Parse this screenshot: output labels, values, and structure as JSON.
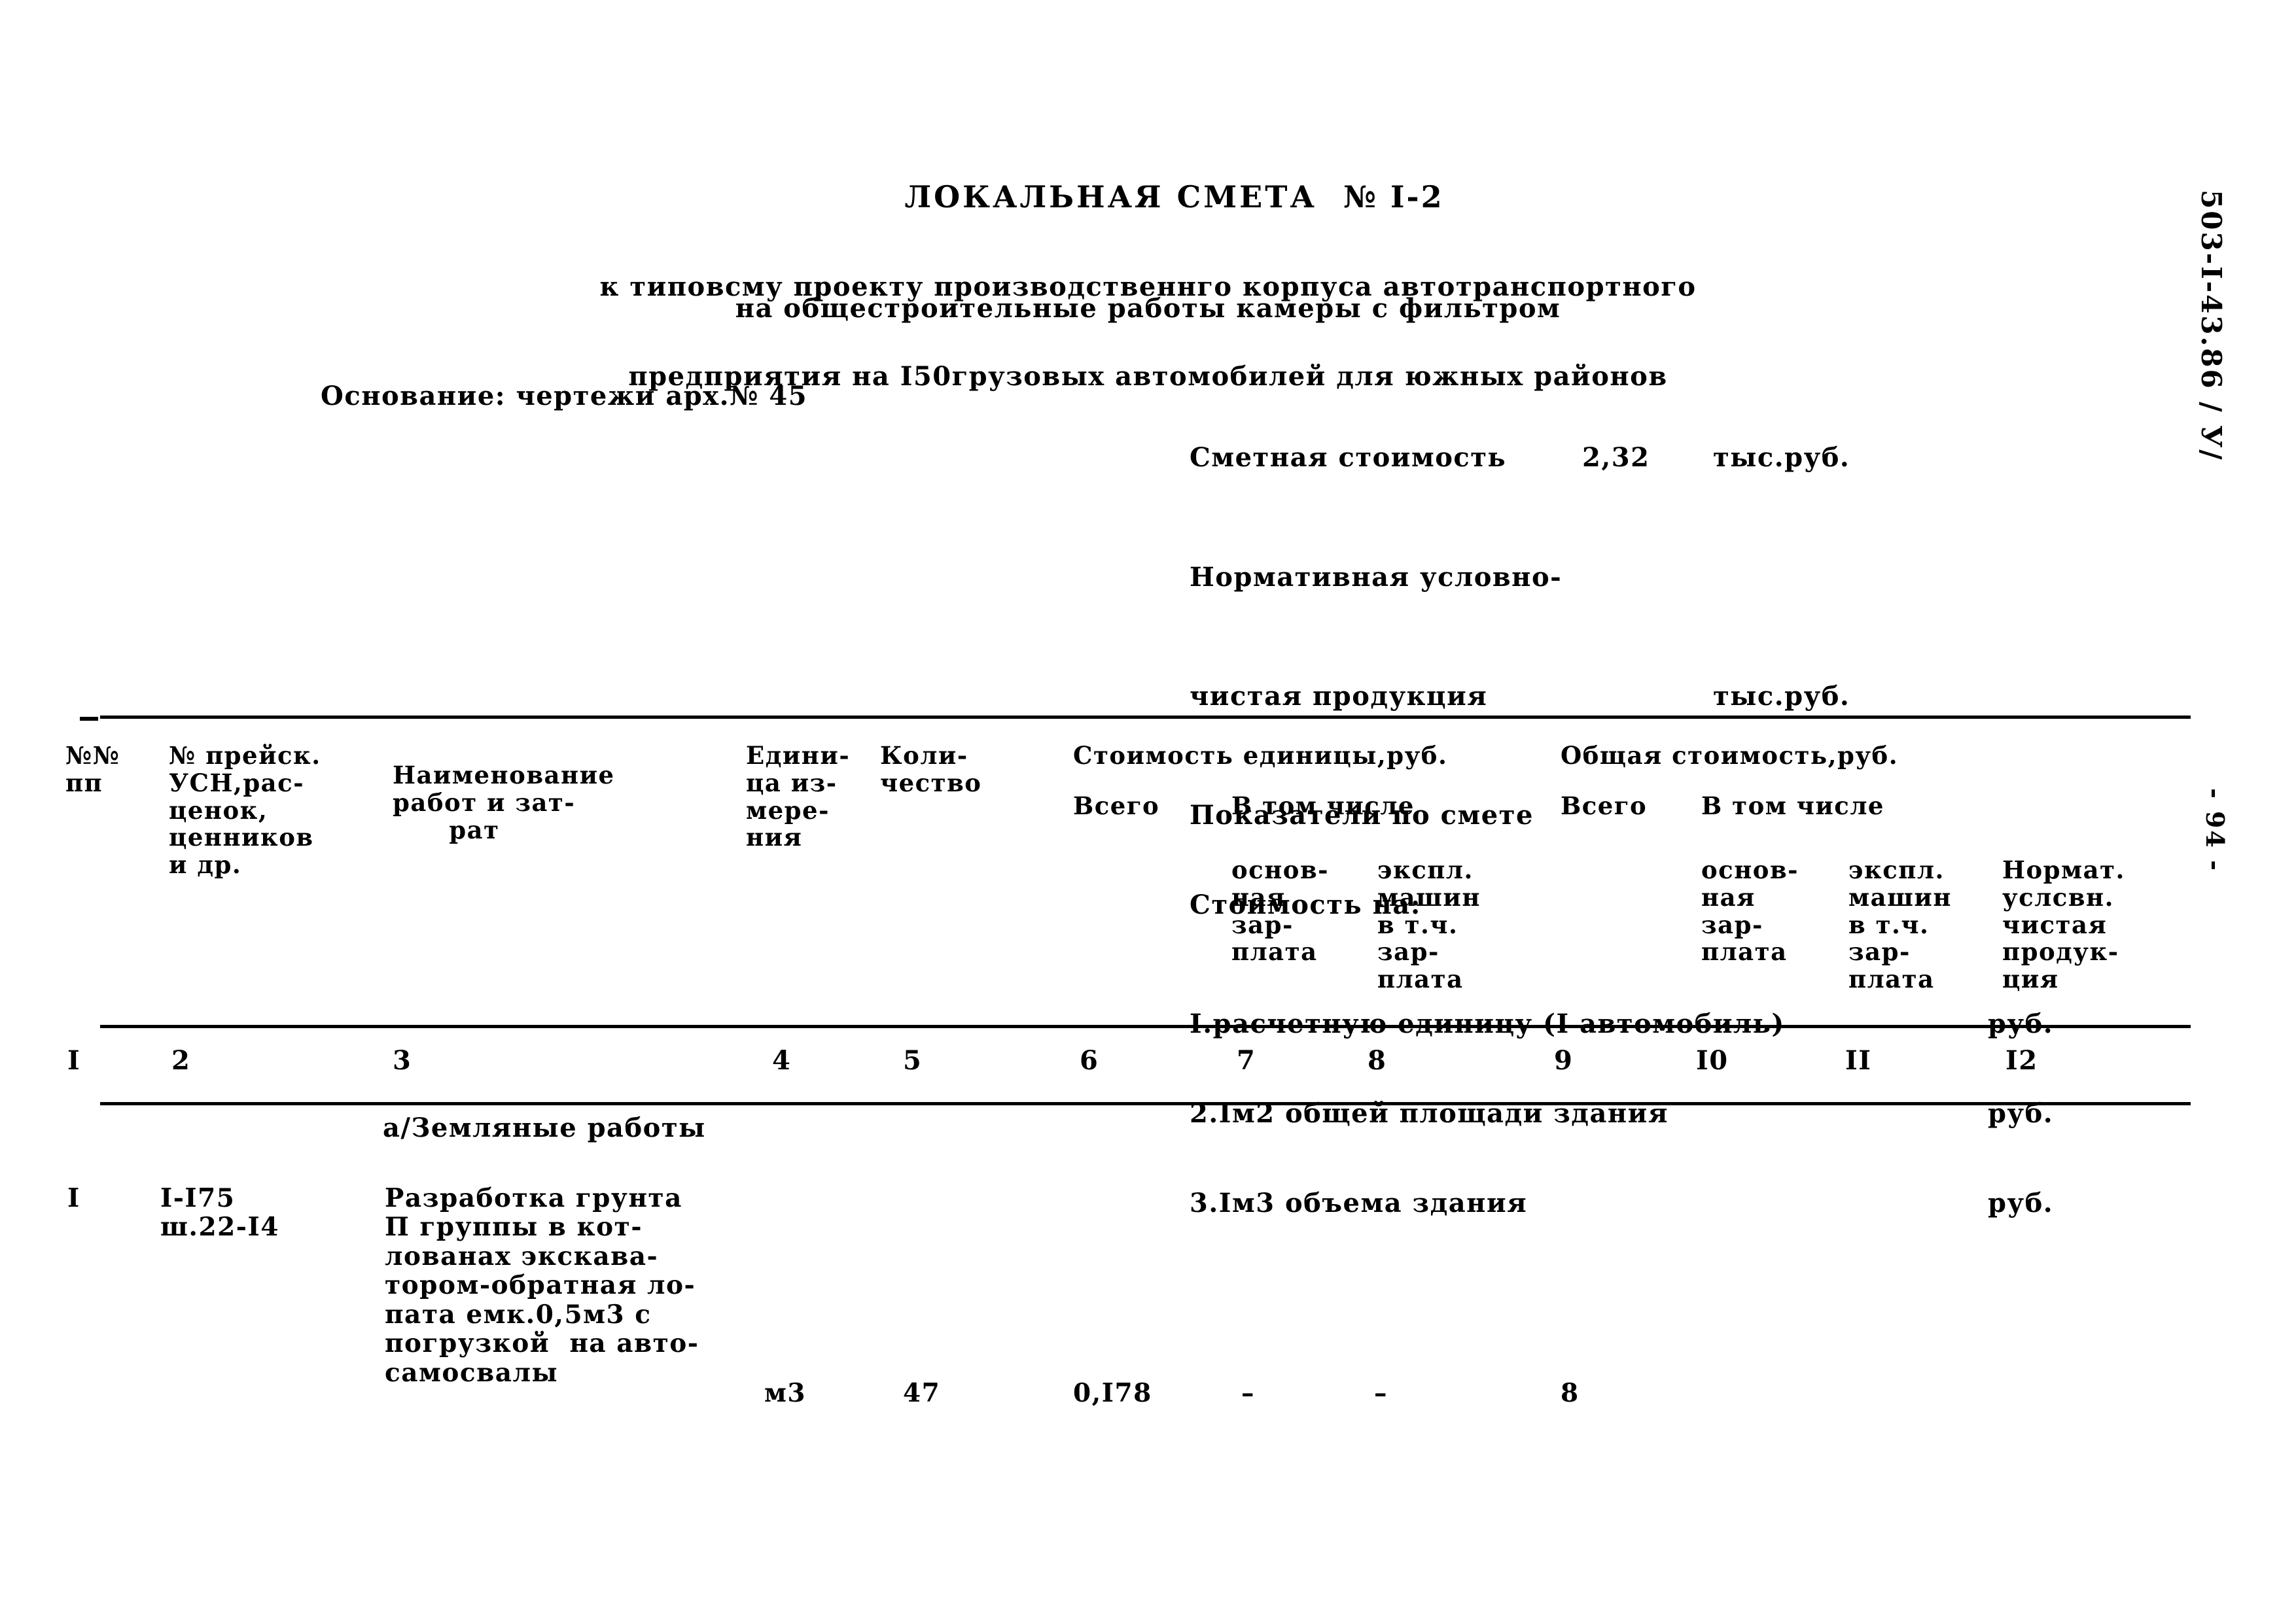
{
  "document": {
    "title_main": "ЛОКАЛЬНАЯ СМЕТА",
    "title_number": "№ I-2",
    "subtitle_line1": "к типовсму проекту производственнго кoрпуса автотранспортного",
    "subtitle_line2": "предприятия на I50грузовых автомобилей для южных районов",
    "subtitle_line3": "на общестроительные работы камеры с фильтром",
    "basis": "Основание: чертежи арх.№ 45",
    "margin_code": "503-I-43.86 / У/",
    "page_number": "- 94 -"
  },
  "summary": {
    "estimate_cost_label": "Сметная стоимость",
    "estimate_cost_value": "2,32",
    "estimate_cost_unit": "тыс.руб.",
    "net_output_label_line1": "Нормативная условно-",
    "net_output_label_line2": "чистая продукция",
    "net_output_value": "",
    "net_output_unit": "тыс.руб.",
    "indicators_label": "Показатели по смете",
    "cost_per_label": "Стоимость на:",
    "items": [
      {
        "label": "I.расчетную единицу (I автомобиль)",
        "value": "",
        "unit": "руб."
      },
      {
        "label": "2.Iм2 общей площади здания",
        "value": "",
        "unit": "руб."
      },
      {
        "label": "3.Iм3 объема здания",
        "value": "",
        "unit": "руб."
      }
    ]
  },
  "table": {
    "headers": {
      "c1": "№№\nпп",
      "c2": "№ прейск.\nУСН,рас-\nценок,\nценников\nи др.",
      "c3": "Наименование\nработ и зат-\n      рат",
      "c4": "Едини-\nца из-\nмере-\nния",
      "c5": "Коли-\nчество",
      "group_unit_cost": "Стоимость единицы,руб.",
      "group_total_cost": "Общая стоимость,руб.",
      "c6": "Всего",
      "c7_8_group": "В том числе",
      "c7": "основ-\nная\nзар-\nплата",
      "c8": "экспл.\nмашин\nв т.ч.\nзар-\nплата",
      "c9": "Всего",
      "c10_11_group": "В том числе",
      "c10": "основ-\nная\nзар-\nплата",
      "c11": "экспл.\nмашин\nв т.ч.\nзар-\nплата",
      "c12": "Нормат.\nуслсвн.\nчистая\nпродук-\nция"
    },
    "column_numbers": [
      "I",
      "2",
      "3",
      "4",
      "5",
      "6",
      "7",
      "8",
      "9",
      "I0",
      "II",
      "I2"
    ],
    "section_label": "а/Земляные работы",
    "rows": [
      {
        "c1": "I",
        "c2": "I-I75\nш.22-I4",
        "c3": "Разработка грунта\nП группы в кот-\nлованах экскава-\nтором-обратная ло-\nпата емк.0,5м3 с\nпогрузкой  на авто-\nсамосвалы",
        "c4": "м3",
        "c5": "47",
        "c6": "0,I78",
        "c7": "–",
        "c8": "–",
        "c9": "8",
        "c10": "",
        "c11": "",
        "c12": ""
      }
    ]
  }
}
